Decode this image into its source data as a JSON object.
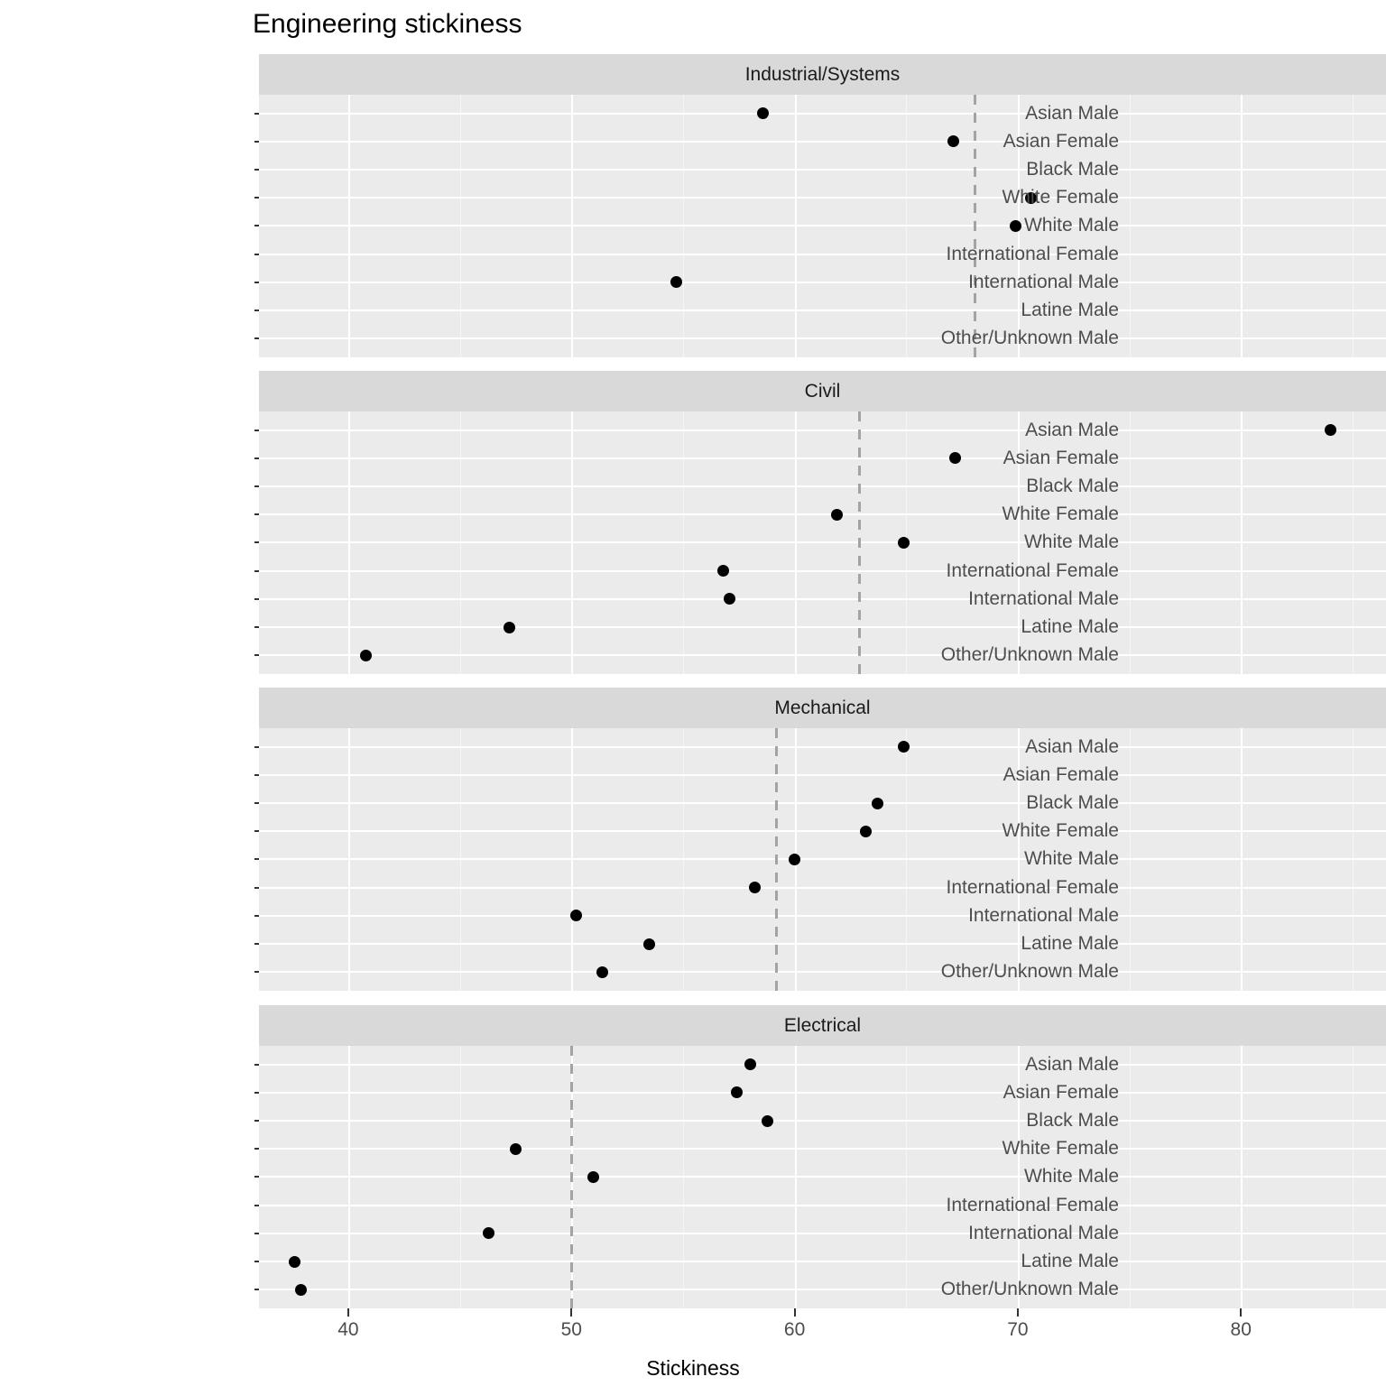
{
  "title": "Engineering stickiness",
  "axis": {
    "x_title": "Stickiness",
    "x_ticks": [
      40,
      50,
      60,
      70,
      80
    ],
    "x_tick_labels": [
      "40",
      "50",
      "60",
      "70",
      "80"
    ]
  },
  "chart_data": {
    "type": "scatter",
    "title": "Engineering stickiness",
    "xlabel": "Stickiness",
    "ylabel": "",
    "xlim": [
      36.0,
      86.5
    ],
    "grid": true,
    "legend": "none",
    "facet_layout": "rows",
    "categories": [
      "Asian Male",
      "Asian Female",
      "Black Male",
      "White Female",
      "White Male",
      "International Female",
      "International Male",
      "Latine Male",
      "Other/Unknown Male"
    ],
    "panels": [
      {
        "name": "Industrial/Systems",
        "reference_line": 68.1,
        "points": [
          {
            "category": "Asian Male",
            "value": 58.6
          },
          {
            "category": "Asian Female",
            "value": 67.1
          },
          {
            "category": "Black Male",
            "value": null
          },
          {
            "category": "White Female",
            "value": 70.6
          },
          {
            "category": "White Male",
            "value": 69.9
          },
          {
            "category": "International Female",
            "value": null
          },
          {
            "category": "International Male",
            "value": 54.7
          },
          {
            "category": "Latine Male",
            "value": null
          },
          {
            "category": "Other/Unknown Male",
            "value": null
          }
        ]
      },
      {
        "name": "Civil",
        "reference_line": 62.9,
        "points": [
          {
            "category": "Asian Male",
            "value": 84.0
          },
          {
            "category": "Asian Female",
            "value": 67.2
          },
          {
            "category": "Black Male",
            "value": null
          },
          {
            "category": "White Female",
            "value": 61.9
          },
          {
            "category": "White Male",
            "value": 64.9
          },
          {
            "category": "International Female",
            "value": 56.8
          },
          {
            "category": "International Male",
            "value": 57.1
          },
          {
            "category": "Latine Male",
            "value": 47.2
          },
          {
            "category": "Other/Unknown Male",
            "value": 40.8
          }
        ]
      },
      {
        "name": "Mechanical",
        "reference_line": 59.2,
        "points": [
          {
            "category": "Asian Male",
            "value": 64.9
          },
          {
            "category": "Asian Female",
            "value": null
          },
          {
            "category": "Black Male",
            "value": 63.7
          },
          {
            "category": "White Female",
            "value": 63.2
          },
          {
            "category": "White Male",
            "value": 60.0
          },
          {
            "category": "International Female",
            "value": 58.2
          },
          {
            "category": "International Male",
            "value": 50.2
          },
          {
            "category": "Latine Male",
            "value": 53.5
          },
          {
            "category": "Other/Unknown Male",
            "value": 51.4
          }
        ]
      },
      {
        "name": "Electrical",
        "reference_line": 50.0,
        "points": [
          {
            "category": "Asian Male",
            "value": 58.0
          },
          {
            "category": "Asian Female",
            "value": 57.4
          },
          {
            "category": "Black Male",
            "value": 58.8
          },
          {
            "category": "White Female",
            "value": 47.5
          },
          {
            "category": "White Male",
            "value": 51.0
          },
          {
            "category": "International Female",
            "value": null
          },
          {
            "category": "International Male",
            "value": 46.3
          },
          {
            "category": "Latine Male",
            "value": 37.6
          },
          {
            "category": "Other/Unknown Male",
            "value": 37.9
          }
        ]
      }
    ]
  },
  "colors": {
    "panel_background": "#ebebeb",
    "strip_background": "#d9d9d9",
    "gridline": "#ffffff",
    "point": "#000000",
    "reference_line": "#a3a3a3",
    "text": "#4d4d4d"
  }
}
